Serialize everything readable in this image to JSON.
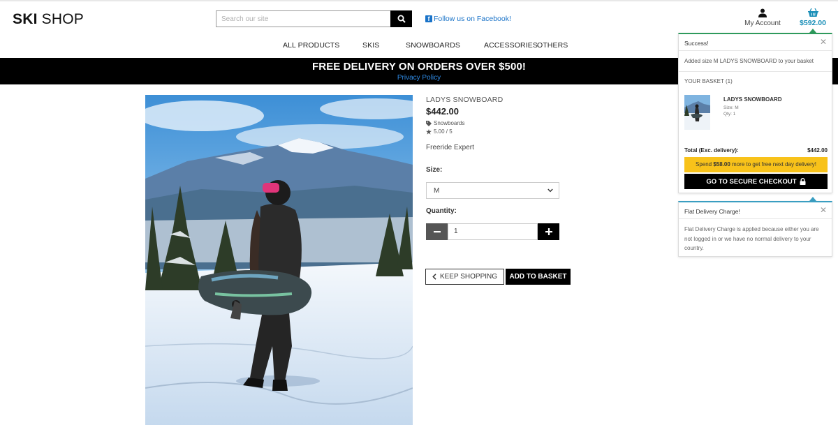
{
  "header": {
    "logo_bold": "SKI",
    "logo_light": "SHOP",
    "search_placeholder": "Search our site",
    "facebook_label": "Follow us on Facebook!",
    "account_label": "My Account",
    "basket_total": "$592.00"
  },
  "nav": {
    "items": [
      "ALL PRODUCTS",
      "SKIS",
      "SNOWBOARDS",
      "ACCESSORIES",
      "OTHERS"
    ]
  },
  "banner": {
    "title": "FREE DELIVERY ON ORDERS OVER $500!",
    "link": "Privacy Policy"
  },
  "product": {
    "name": "LADYS SNOWBOARD",
    "price": "$442.00",
    "category": "Snowboards",
    "rating": "5.00 / 5",
    "description": "Freeride Expert",
    "size_label": "Size:",
    "size_value": "M",
    "quantity_label": "Quantity:",
    "quantity_value": "1",
    "keep_shopping": "KEEP SHOPPING",
    "add_to_basket": "ADD TO BASKET"
  },
  "toast_success": {
    "title": "Success!",
    "message": "Added size M LADYS SNOWBOARD to your basket",
    "basket_heading": "YOUR BASKET (1)",
    "item_name": "LADYS SNOWBOARD",
    "item_size": "Size: M",
    "item_qty": "Qty: 1",
    "total_label": "Total (Exc. delivery):",
    "total_value": "$442.00",
    "spend_prefix": "Spend ",
    "spend_amount": "$58.00",
    "spend_suffix": " more to get free next day delivery!",
    "checkout_label": "GO TO SECURE CHECKOUT"
  },
  "toast_info": {
    "title": "Flat Delivery Charge!",
    "message": "Flat Delivery Charge is applied because either you are not logged in or we have no normal delivery to your country."
  },
  "colors": {
    "accent_blue": "#1a8fb8",
    "link_blue": "#2f8be6",
    "success_green": "#2e9a5c",
    "info_blue": "#3a9ec1",
    "spend_yellow": "#f8c21a"
  },
  "icons": {
    "search": "search-icon",
    "facebook": "facebook-icon",
    "account": "user-icon",
    "basket": "basket-icon",
    "tag": "tag-icon",
    "star": "star-icon",
    "chevron_down": "chevron-down-icon",
    "minus": "minus-icon",
    "plus": "plus-icon",
    "chevron_left": "chevron-left-icon",
    "lock": "lock-icon",
    "close": "close-icon"
  }
}
